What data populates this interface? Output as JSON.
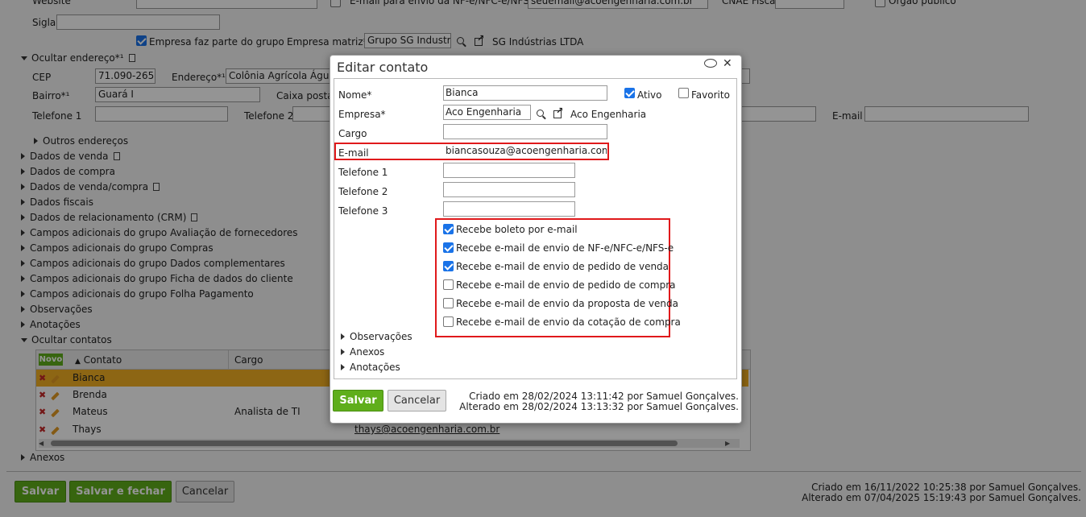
{
  "page": {
    "website_label": "Website",
    "nfe_email_label": "E-mail para envio da NF-e/NFC-e/NFS-e",
    "nfe_email_value": "seuemail@acoengenharia.com.br",
    "cnae_label": "CNAE Fiscal",
    "orgao_label": "Órgão público",
    "sigla_label": "Sigla",
    "grupo_checkbox_label": "Empresa faz parte do grupo",
    "matriz_label": "Empresa matriz*",
    "matriz_value": "Grupo SG Industria",
    "matriz_link": "SG Indústrias LTDA",
    "endereco_section": "Ocultar endereço*¹",
    "cep_label": "CEP",
    "cep_value": "71.090-265",
    "endereco_label": "Endereço*¹",
    "endereco_value": "Colônia Agrícola Águas",
    "bairro_label": "Bairro*¹",
    "bairro_value": "Guará I",
    "caixa_postal_label": "Caixa postal",
    "telefone1_label": "Telefone 1",
    "telefone2_label": "Telefone 2",
    "email_label": "E-mail",
    "outros_enderecos": "Outros endereços",
    "sections": [
      "Dados de venda",
      "Dados de compra",
      "Dados de venda/compra",
      "Dados fiscais",
      "Dados de relacionamento (CRM)",
      "Campos adicionais do grupo Avaliação de fornecedores",
      "Campos adicionais do grupo Compras",
      "Campos adicionais do grupo Dados complementares",
      "Campos adicionais do grupo Ficha de dados do cliente",
      "Campos adicionais do grupo Folha Pagamento",
      "Observações",
      "Anotações"
    ],
    "contatos_section": "Ocultar contatos",
    "anexos_section": "Anexos",
    "grid": {
      "novo_label": "Novo",
      "col_contato": "Contato",
      "col_cargo": "Cargo",
      "rows": [
        {
          "contato": "Bianca",
          "cargo": "",
          "email": ""
        },
        {
          "contato": "Brenda",
          "cargo": "",
          "email": ""
        },
        {
          "contato": "Mateus",
          "cargo": "Analista de TI",
          "email": ""
        },
        {
          "contato": "Thays",
          "cargo": "",
          "email": "thays@acoengenharia.com.br"
        }
      ]
    },
    "salvar": "Salvar",
    "salvar_fechar": "Salvar e fechar",
    "cancelar": "Cancelar",
    "criado": "Criado em 16/11/2022 10:25:38 por Samuel Gonçalves.",
    "alterado": "Alterado em 07/04/2025 15:19:43 por Samuel Gonçalves."
  },
  "dialog": {
    "title": "Editar contato",
    "nome_label": "Nome*",
    "nome_value": "Bianca",
    "ativo_label": "Ativo",
    "favorito_label": "Favorito",
    "empresa_label": "Empresa*",
    "empresa_value": "Aco Engenharia",
    "empresa_link": "Aco Engenharia",
    "cargo_label": "Cargo",
    "email_label": "E-mail",
    "email_value": "biancasouza@acoengenharia.com",
    "tel1_label": "Telefone 1",
    "tel2_label": "Telefone 2",
    "tel3_label": "Telefone 3",
    "options": [
      {
        "label": "Recebe boleto por e-mail",
        "checked": true
      },
      {
        "label": "Recebe e-mail de envio de NF-e/NFC-e/NFS-e",
        "checked": true
      },
      {
        "label": "Recebe e-mail de envio de pedido de venda",
        "checked": true
      },
      {
        "label": "Recebe e-mail de envio de pedido de compra",
        "checked": false
      },
      {
        "label": "Recebe e-mail de envio da proposta de venda",
        "checked": false
      },
      {
        "label": "Recebe e-mail de envio da cotação de compra",
        "checked": false
      }
    ],
    "sub_sections": [
      "Observações",
      "Anexos",
      "Anotações"
    ],
    "salvar": "Salvar",
    "cancelar": "Cancelar",
    "criado": "Criado em 28/02/2024 13:11:42 por Samuel Gonçalves.",
    "alterado": "Alterado em 28/02/2024 13:13:32 por Samuel Gonçalves."
  }
}
